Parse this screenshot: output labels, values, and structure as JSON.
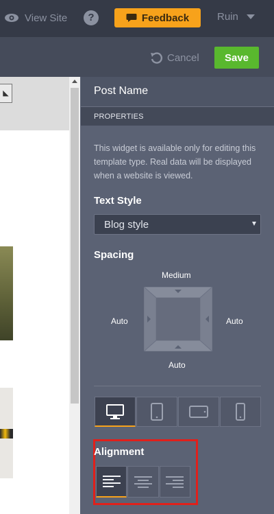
{
  "topbar": {
    "view_site_label": "View Site",
    "help_label": "?",
    "feedback_label": "Feedback",
    "user_label": "Ruin"
  },
  "toolbar": {
    "cancel_label": "Cancel",
    "save_label": "Save"
  },
  "panel": {
    "title": "Post Name",
    "section_header": "PROPERTIES",
    "description": "This widget is available only for editing this template type. Real data will be displayed when a website is viewed.",
    "text_style": {
      "label": "Text Style",
      "selected": "Blog style"
    },
    "spacing": {
      "label": "Spacing",
      "top": "Medium",
      "left": "Auto",
      "right": "Auto",
      "bottom": "Auto"
    },
    "devices": [
      "desktop-icon",
      "tablet-portrait-icon",
      "tablet-landscape-icon",
      "mobile-icon"
    ],
    "alignment": {
      "label": "Alignment",
      "options": [
        "align-left-icon",
        "align-center-icon",
        "align-right-icon"
      ],
      "selected": "align-left-icon"
    }
  },
  "colors": {
    "accent": "#f7a21b",
    "save": "#59b82e",
    "highlight": "#e0201b"
  }
}
